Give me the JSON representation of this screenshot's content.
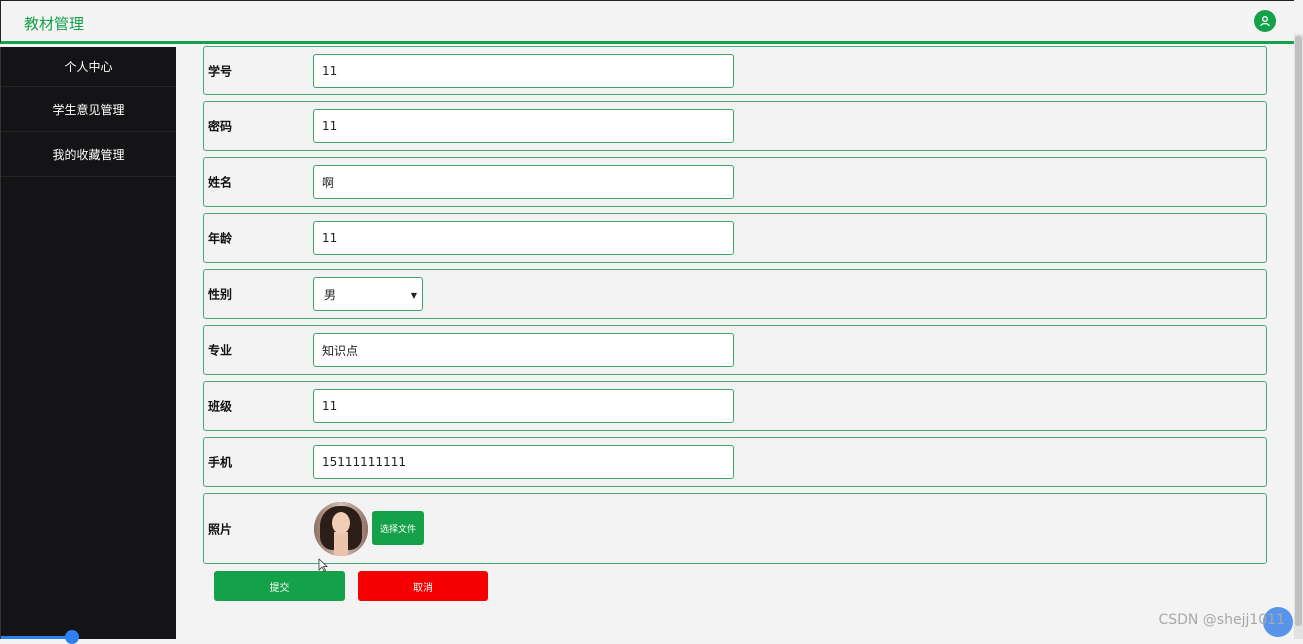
{
  "header": {
    "title": "教材管理",
    "user_icon": "user-icon"
  },
  "sidebar": {
    "items": [
      {
        "label": "个人中心"
      },
      {
        "label": "学生意见管理"
      },
      {
        "label": "我的收藏管理"
      }
    ]
  },
  "form": {
    "fields": [
      {
        "label": "学号",
        "value": "11"
      },
      {
        "label": "密码",
        "value": "11"
      },
      {
        "label": "姓名",
        "value": "啊"
      },
      {
        "label": "年龄",
        "value": "11"
      },
      {
        "label": "性别",
        "value": "男"
      },
      {
        "label": "专业",
        "value": "知识点"
      },
      {
        "label": "班级",
        "value": "11"
      },
      {
        "label": "手机",
        "value": "15111111111"
      },
      {
        "label": "照片"
      }
    ],
    "file_button": "选择文件",
    "submit": "提交",
    "cancel": "取消"
  },
  "watermark": "CSDN @shejj1011",
  "colors": {
    "accent": "#15a04a",
    "danger": "#f40000",
    "sidebar": "#141316"
  }
}
